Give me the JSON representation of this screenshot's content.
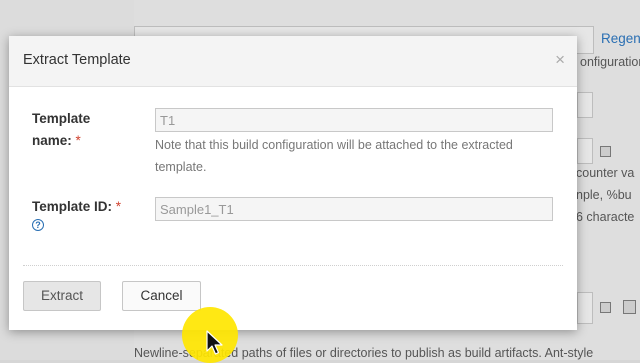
{
  "background": {
    "right_link": "Regen",
    "config_text": "onfiguration",
    "counter_text": "counter va",
    "sample_text": "nple, %bu",
    "chars_text": "6 characte",
    "bottom_text": "Newline-separated paths of files or directories to publish as build artifacts. Ant-style"
  },
  "dialog": {
    "title": "Extract Template",
    "close_symbol": "×",
    "template_name": {
      "label": "Template name:",
      "required_mark": "*",
      "value": "T1",
      "note": "Note that this build configuration will be attached to the extracted template."
    },
    "template_id": {
      "label": "Template ID:",
      "required_mark": "*",
      "help_symbol": "?",
      "value": "Sample1_T1"
    },
    "buttons": {
      "extract": "Extract",
      "cancel": "Cancel"
    }
  },
  "colors": {
    "accent_link": "#2a6fb3",
    "required": "#d0412e",
    "cursor_highlight": "#ffe600"
  }
}
